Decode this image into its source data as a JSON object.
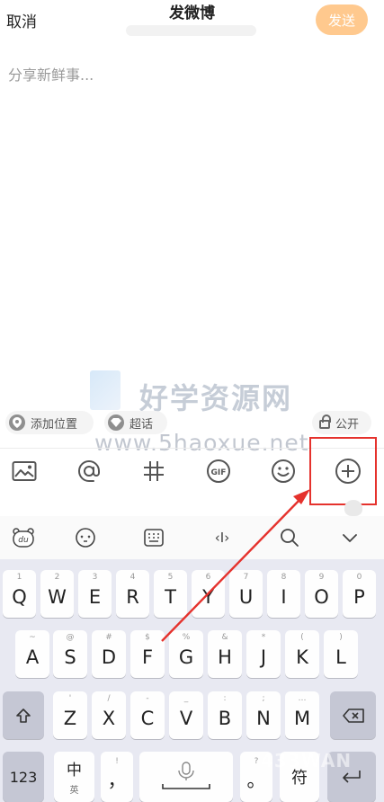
{
  "header": {
    "cancel_label": "取消",
    "title": "发微博",
    "send_label": "发送"
  },
  "compose": {
    "placeholder": "分享新鲜事..."
  },
  "watermark": {
    "line1": "好学资源网",
    "line2": "www.5haoxue.net"
  },
  "chips": {
    "location_label": "添加位置",
    "topic_label": "超话",
    "visibility_label": "公开"
  },
  "toolbar": {
    "items": [
      "image-icon",
      "mention-icon",
      "hashtag-icon",
      "gif-icon",
      "emoji-icon",
      "more-plus-icon"
    ],
    "gif_text": "GIF"
  },
  "ime_bar": {
    "items": [
      "ime-logo-icon",
      "ime-emoticon-icon",
      "ime-keyboard-icon",
      "ime-cursor-icon",
      "ime-search-icon",
      "ime-collapse-icon"
    ],
    "cursor_text": "‹I›",
    "logo_text": "du"
  },
  "keyboard": {
    "row1": [
      {
        "main": "Q",
        "sub": "1"
      },
      {
        "main": "W",
        "sub": "2"
      },
      {
        "main": "E",
        "sub": "3"
      },
      {
        "main": "R",
        "sub": "4"
      },
      {
        "main": "T",
        "sub": "5"
      },
      {
        "main": "Y",
        "sub": "6"
      },
      {
        "main": "U",
        "sub": "7"
      },
      {
        "main": "I",
        "sub": "8"
      },
      {
        "main": "O",
        "sub": "9"
      },
      {
        "main": "P",
        "sub": "0"
      }
    ],
    "row2": [
      {
        "main": "A",
        "sub": "~"
      },
      {
        "main": "S",
        "sub": "@"
      },
      {
        "main": "D",
        "sub": "#"
      },
      {
        "main": "F",
        "sub": "$"
      },
      {
        "main": "G",
        "sub": "%"
      },
      {
        "main": "H",
        "sub": "&"
      },
      {
        "main": "J",
        "sub": "*"
      },
      {
        "main": "K",
        "sub": "("
      },
      {
        "main": "L",
        "sub": ")"
      }
    ],
    "row3": [
      {
        "main": "Z",
        "sub": "'"
      },
      {
        "main": "X",
        "sub": "/"
      },
      {
        "main": "C",
        "sub": "-"
      },
      {
        "main": "V",
        "sub": "_"
      },
      {
        "main": "B",
        "sub": ":"
      },
      {
        "main": "N",
        "sub": ";"
      },
      {
        "main": "M",
        "sub": "…"
      }
    ],
    "num_label": "123",
    "lang_main": "中",
    "lang_sub": "英",
    "comma_main": "，",
    "comma_sub": "!",
    "period_main": "。",
    "period_sub": "?",
    "symbol_label": "符",
    "bottom_watermark": "433WAN"
  },
  "colors": {
    "send_button": "#ffc98e",
    "highlight_box": "#e5322d",
    "keyboard_bg": "#e8e9f2"
  }
}
